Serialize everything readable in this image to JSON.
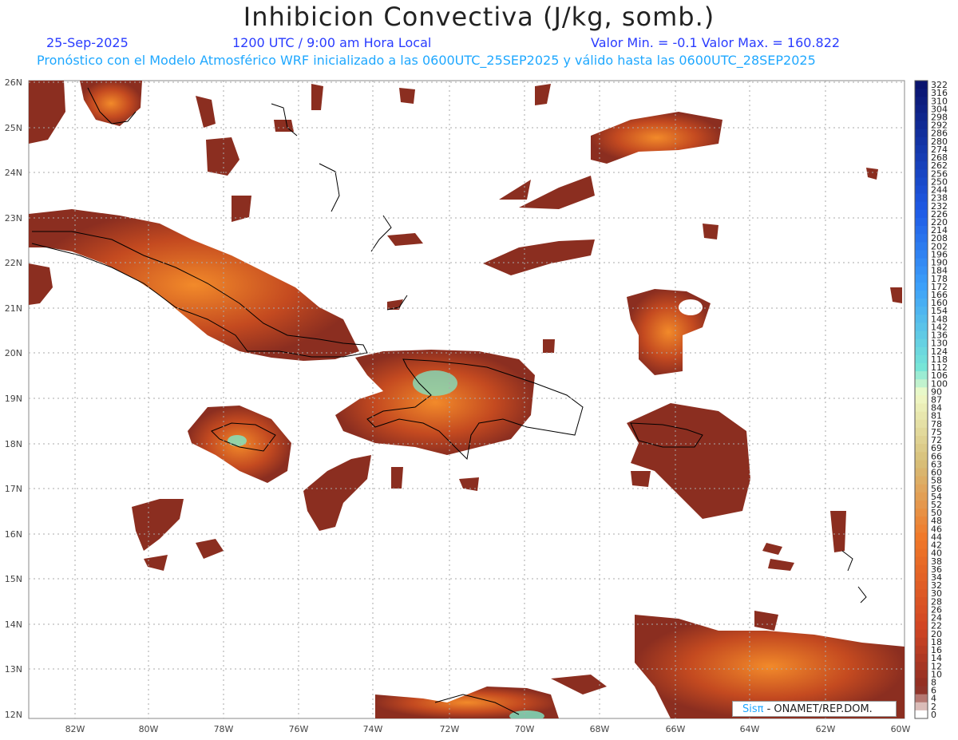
{
  "header": {
    "title": "Inhibicion Convectiva (J/kg, somb.)",
    "date": "25-Sep-2025",
    "time": "1200 UTC / 9:00 am Hora Local",
    "minmax": "Valor Min. = -0.1  Valor Max. = 160.822",
    "model_line": "Pronóstico con el Modelo Atmosférico WRF inicializado a las 0600UTC_25SEP2025 y válido hasta las  0600UTC_28SEP2025"
  },
  "credit": {
    "brand": "Sisπ",
    "text": " - ONAMET/REP.DOM."
  },
  "axes": {
    "lat_labels": [
      "26N",
      "25N",
      "24N",
      "23N",
      "22N",
      "21N",
      "20N",
      "19N",
      "18N",
      "17N",
      "16N",
      "15N",
      "14N",
      "13N",
      "12N"
    ],
    "lon_labels": [
      "82W",
      "80W",
      "78W",
      "76W",
      "74W",
      "72W",
      "70W",
      "68W",
      "66W",
      "64W",
      "62W",
      "60W"
    ]
  },
  "colorbar": {
    "labels": [
      "322",
      "316",
      "310",
      "304",
      "298",
      "292",
      "286",
      "280",
      "274",
      "268",
      "262",
      "256",
      "250",
      "244",
      "238",
      "232",
      "226",
      "220",
      "214",
      "208",
      "202",
      "196",
      "190",
      "184",
      "178",
      "172",
      "166",
      "160",
      "154",
      "148",
      "142",
      "136",
      "130",
      "124",
      "118",
      "112",
      "106",
      "100",
      "90",
      "87",
      "84",
      "81",
      "78",
      "75",
      "72",
      "69",
      "66",
      "63",
      "60",
      "58",
      "56",
      "54",
      "52",
      "50",
      "48",
      "46",
      "44",
      "42",
      "40",
      "38",
      "36",
      "34",
      "32",
      "30",
      "28",
      "26",
      "24",
      "22",
      "20",
      "18",
      "16",
      "14",
      "12",
      "10",
      "8",
      "6",
      "4",
      "2",
      "0"
    ]
  },
  "colors": {
    "field_low": "#8b2e20",
    "field_mid": "#c84a1e",
    "field_high": "#f07a20",
    "field_peak": "#7de8c8"
  }
}
